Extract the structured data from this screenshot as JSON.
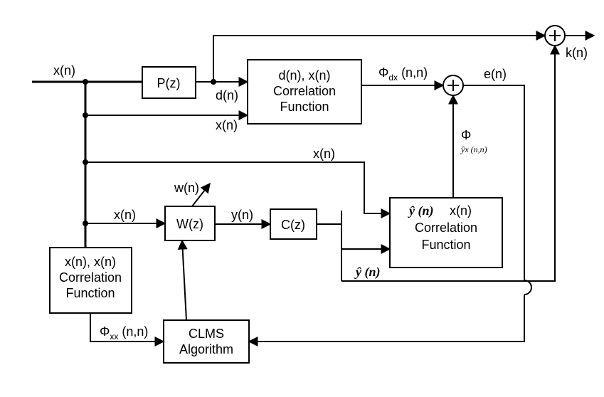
{
  "blocks": {
    "P": "P(z)",
    "W": "W(z)",
    "C": "C(z)",
    "corr_dx_line1": "d(n), x(n)",
    "corr_dx_line2": "Correlation",
    "corr_dx_line3": "Function",
    "corr_yx_line1_a": "ŷ (n)",
    "corr_yx_line1_b": " x(n)",
    "corr_yx_line2": "Correlation",
    "corr_yx_line3": "Function",
    "corr_xx_line1": "x(n), x(n)",
    "corr_xx_line2": "Correlation",
    "corr_xx_line3": "Function",
    "clms_line1": "CLMS",
    "clms_line2": "Algorithm"
  },
  "signals": {
    "x_in": "x(n)",
    "x_top2": "x(n)",
    "d": "d(n)",
    "x_to_W": "x(n)",
    "w": "w(n)",
    "y": "y(n)",
    "x_to_yx": "x(n)",
    "yhat": "ŷ (n)",
    "phi_dx": "Φ",
    "phi_dx_sub": "dx",
    "phi_dx_arg": " (n,n)",
    "e": "e(n)",
    "k": "k(n)",
    "phi_yx_sub": "ŷx (n,n)",
    "phi_yx_icon": "Φ",
    "phi_xx": "Φ",
    "phi_xx_sub": "xx",
    "phi_xx_arg": " (n,n)"
  }
}
